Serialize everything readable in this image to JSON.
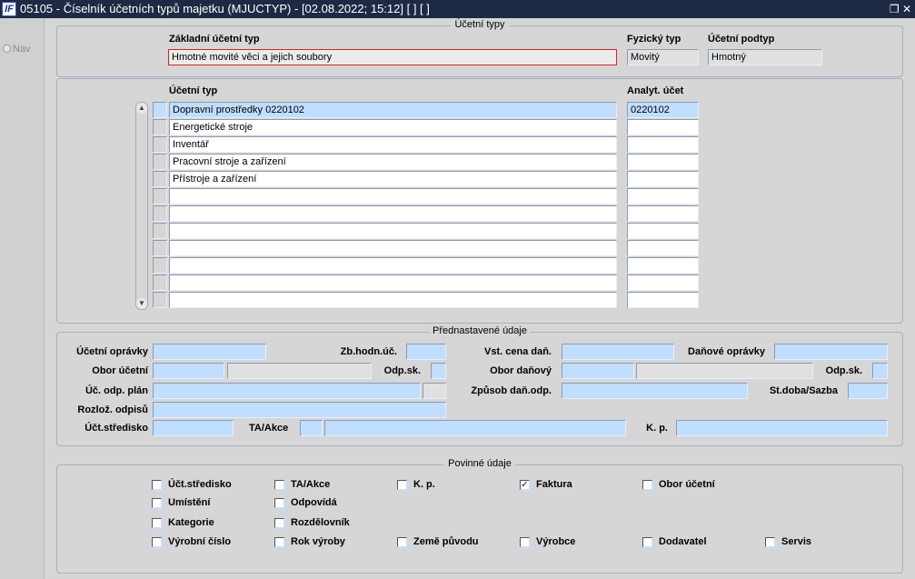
{
  "window": {
    "title": "05105 - Číselník účetních typů majetku (MJUCTYP) - [02.08.2022; 15:12]  [ ]  [ ]",
    "logo": "IF",
    "restore_icon": "❐",
    "close_icon": "✕"
  },
  "nav": {
    "label": "Nav"
  },
  "ucetni_typy": {
    "title": "Účetní typy",
    "zakladni_label": "Základní účetní typ",
    "zakladni_value": "Hmotné movité věci a jejich soubory",
    "fyzicky_label": "Fyzický typ",
    "fyzicky_value": "Movitý",
    "podtyp_label": "Účetní podtyp",
    "podtyp_value": "Hmotný"
  },
  "grid": {
    "col_typ": "Účetní typ",
    "col_analyt": "Analyt. účet",
    "rows": [
      {
        "typ": "Dopravní prostředky 0220102",
        "analyt": "0220102"
      },
      {
        "typ": "Energetické stroje",
        "analyt": ""
      },
      {
        "typ": "Inventář",
        "analyt": ""
      },
      {
        "typ": "Pracovní stroje a zařízení",
        "analyt": ""
      },
      {
        "typ": "Přístroje a zařízení",
        "analyt": ""
      },
      {
        "typ": "",
        "analyt": ""
      },
      {
        "typ": "",
        "analyt": ""
      },
      {
        "typ": "",
        "analyt": ""
      },
      {
        "typ": "",
        "analyt": ""
      },
      {
        "typ": "",
        "analyt": ""
      },
      {
        "typ": "",
        "analyt": ""
      },
      {
        "typ": "",
        "analyt": ""
      }
    ]
  },
  "prednastavene": {
    "title": "Přednastavené údaje",
    "ucetni_opravky": "Účetní oprávky",
    "zb_hodn": "Zb.hodn.úč.",
    "vst_cena": "Vst. cena daň.",
    "danove_opravky": "Daňové oprávky",
    "obor_ucetni": "Obor účetní",
    "odp_sk": "Odp.sk.",
    "obor_danovy": "Obor daňový",
    "odp_sk2": "Odp.sk.",
    "uc_odp_plan": "Úč. odp. plán",
    "zpusob": "Způsob daň.odp.",
    "st_doba": "St.doba/Sazba",
    "rozloz": "Rozlož. odpisů",
    "stredisko": "Účt.středisko",
    "ta_akce": "TA/Akce",
    "kp": "K. p."
  },
  "povinne": {
    "title": "Povinné údaje",
    "items": [
      {
        "label": "Účt.středisko",
        "checked": false
      },
      {
        "label": "TA/Akce",
        "checked": false
      },
      {
        "label": "K. p.",
        "checked": false
      },
      {
        "label": "Faktura",
        "checked": true
      },
      {
        "label": "Obor účetní",
        "checked": false
      },
      {
        "label": "Umístění",
        "checked": false
      },
      {
        "label": "Odpovídá",
        "checked": false
      },
      {
        "label": "Kategorie",
        "checked": false
      },
      {
        "label": "Rozdělovník",
        "checked": false
      },
      {
        "label": "Výrobní číslo",
        "checked": false
      },
      {
        "label": "Rok výroby",
        "checked": false
      },
      {
        "label": "Země původu",
        "checked": false
      },
      {
        "label": "Výrobce",
        "checked": false
      },
      {
        "label": "Dodavatel",
        "checked": false
      },
      {
        "label": "Servis",
        "checked": false
      }
    ]
  }
}
